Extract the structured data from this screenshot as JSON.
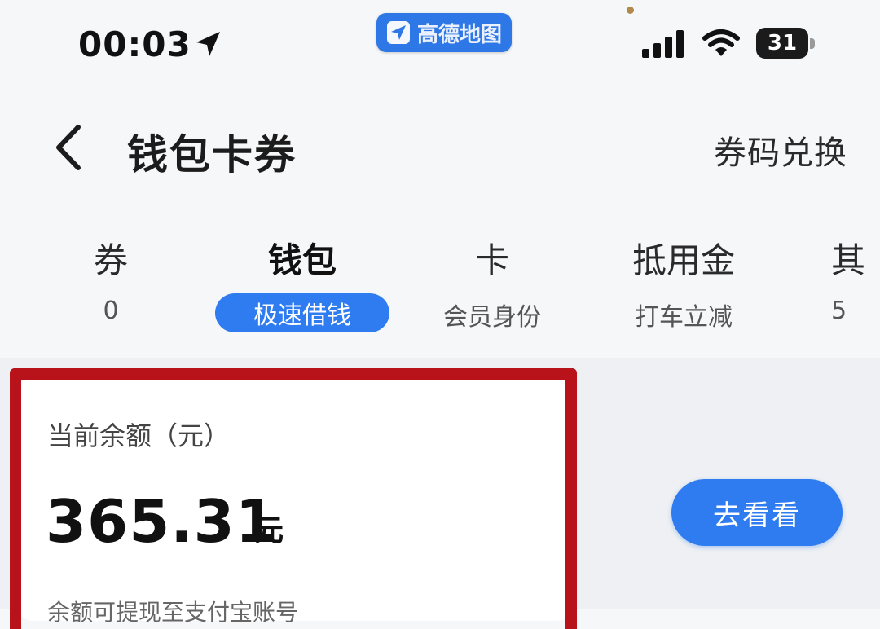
{
  "status_bar": {
    "time": "00:03",
    "maps_app_label": "高德地图",
    "battery_level": "31",
    "icons": [
      "location-arrow-icon",
      "signal-icon",
      "wifi-icon",
      "battery-icon"
    ]
  },
  "nav": {
    "title": "钱包卡券",
    "redeem_label": "券码兑换"
  },
  "tabs": [
    {
      "title": "券",
      "sub": "0",
      "active": false
    },
    {
      "title": "钱包",
      "sub": "极速借钱",
      "active": true
    },
    {
      "title": "卡",
      "sub": "会员身份",
      "active": false
    },
    {
      "title": "抵用金",
      "sub": "打车立减",
      "active": false
    },
    {
      "title": "其",
      "sub": "5",
      "active": false
    }
  ],
  "balance": {
    "label": "当前余额（元）",
    "amount": "365.31",
    "unit": "元",
    "note": "余额可提现至支付宝账号"
  },
  "action": {
    "go_label": "去看看"
  },
  "colors": {
    "accent": "#2f7cf0",
    "highlight_frame": "#b8121b",
    "background": "#f6f7f9"
  }
}
